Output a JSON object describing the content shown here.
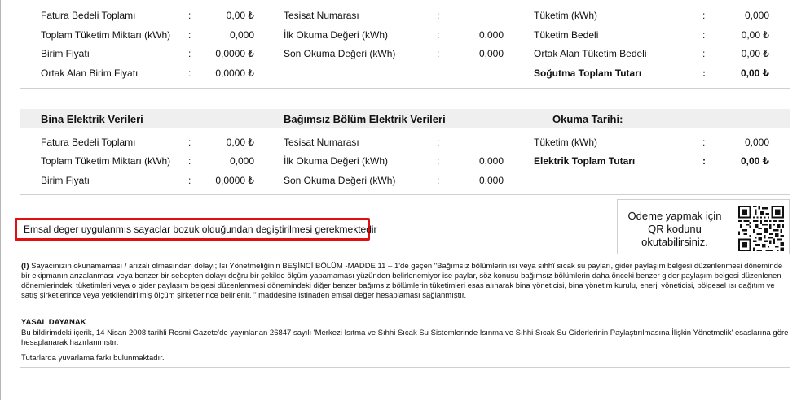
{
  "top_section": {
    "rows": [
      {
        "col1_label": "Fatura Bedeli Toplamı",
        "col1_value": "0,00 ₺",
        "col2_label": "Tesisat Numarası",
        "col2_value": "",
        "col3_label": "Tüketim (kWh)",
        "col3_value": "0,000"
      },
      {
        "col1_label": "Toplam Tüketim Miktarı (kWh)",
        "col1_value": "0,000",
        "col2_label": "İlk Okuma Değeri (kWh)",
        "col2_value": "0,000",
        "col3_label": "Tüketim Bedeli",
        "col3_value": "0,00 ₺"
      },
      {
        "col1_label": "Birim Fiyatı",
        "col1_value": "0,0000 ₺",
        "col2_label": "Son Okuma Değeri (kWh)",
        "col2_value": "0,000",
        "col3_label": "Ortak Alan Tüketim Bedeli",
        "col3_value": "0,00 ₺"
      },
      {
        "col1_label": "Ortak Alan Birim Fiyatı",
        "col1_value": "0,0000 ₺",
        "col2_label": "",
        "col2_value": "",
        "col3_label": "Soğutma Toplam Tutarı",
        "col3_value": "0,00 ₺"
      }
    ]
  },
  "electric_section": {
    "header_building": "Bina Elektrik Verileri",
    "header_unit": "Bağımsız Bölüm Elektrik Verileri",
    "header_reading": "Okuma Tarihi:",
    "rows": [
      {
        "col1_label": "Fatura Bedeli Toplamı",
        "col1_value": "0,00 ₺",
        "col2_label": "Tesisat Numarası",
        "col2_value": "",
        "col3_label": "Tüketim (kWh)",
        "col3_value": "0,000"
      },
      {
        "col1_label": "Toplam Tüketim Miktarı (kWh)",
        "col1_value": "0,000",
        "col2_label": "İlk Okuma Değeri (kWh)",
        "col2_value": "0,000",
        "col3_label": "Elektrik Toplam Tutarı",
        "col3_value": "0,00 ₺"
      },
      {
        "col1_label": "Birim Fiyatı",
        "col1_value": "0,0000 ₺",
        "col2_label": "Son Okuma Değeri (kWh)",
        "col2_value": "0,000",
        "col3_label": "",
        "col3_value": ""
      }
    ]
  },
  "colon": ":",
  "notice_text": "Emsal deger uygulanmıs sayaclar bozuk olduğundan degiştirilmesi gerekmektedir",
  "qr": {
    "line1": "Ödeme yapmak için",
    "line2": "QR kodunu",
    "line3": "okutabilirsiniz."
  },
  "footnote": {
    "marker": "(!)",
    "text": "Sayacınızın okunamaması / arızalı olmasından dolayı; Isı Yönetmeliğinin BEŞİNCİ BÖLÜM -MADDE 11 – 1'de geçen \"Bağımsız bölümlerin ısı veya sıhhî sıcak su payları, gider paylaşım belgesi düzenlenmesi döneminde bir ekipmanın arızalanması veya benzer bir sebepten dolayı doğru bir şekilde ölçüm yapamaması yüzünden belirlenemiyor ise paylar, söz konusu bağımsız bölümlerin daha önceki benzer gider paylaşım belgesi düzenlenen dönemlerindeki tüketimleri veya o gider paylaşım belgesi düzenlenmesi dönemindeki diğer benzer bağımsız bölümlerin tüketimleri esas alınarak bina yöneticisi, bina yönetim kurulu, enerji yöneticisi, bölgesel ısı dağıtım ve satış şirketlerince veya yetkilendirilmiş ölçüm şirketlerince belirlenir. \" maddesine istinaden emsal değer hesaplaması sağlanmıştır."
  },
  "legal": {
    "title": "YASAL DAYANAK",
    "text": "Bu bildirimdeki içerik, 14 Nisan 2008 tarihli Resmi Gazete'de yayınlanan 26847 sayılı 'Merkezi Isıtma ve Sıhhi Sıcak Su Sistemlerinde Isınma ve Sıhhi Sıcak Su Giderlerinin Paylaştırılmasına İlişkin Yönetmelik' esaslarına göre hesaplanarak hazırlanmıştır.",
    "rounding": "Tutarlarda yuvarlama farkı bulunmaktadır."
  }
}
